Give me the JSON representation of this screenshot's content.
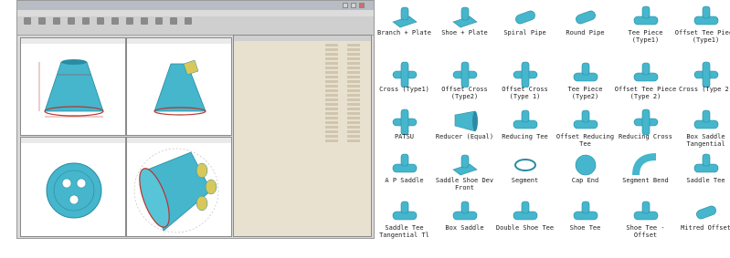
{
  "app": {
    "title": "",
    "menu": [
      "",
      "",
      "",
      "",
      "",
      "",
      ""
    ],
    "toolbar": [
      "",
      "",
      "",
      "",
      "",
      "",
      "",
      "",
      "",
      "",
      "",
      ""
    ],
    "colors": {
      "shape": "#45b6cc",
      "shape_dark": "#2a8ca3",
      "weld": "#b8332c",
      "table_bg": "#e9e1cf"
    }
  },
  "viewports": [
    {
      "view": "front-view"
    },
    {
      "view": "side-view"
    },
    {
      "view": "top-view"
    },
    {
      "view": "3d-view"
    }
  ],
  "palette": {
    "items": [
      {
        "label": "Branch + Plate",
        "icon": "branch-plate-icon"
      },
      {
        "label": "Shoe + Plate",
        "icon": "shoe-plate-icon"
      },
      {
        "label": "Spiral Pipe",
        "icon": "spiral-pipe-icon"
      },
      {
        "label": "Round Pipe",
        "icon": "round-pipe-icon"
      },
      {
        "label": "Tee Piece (Type1)",
        "icon": "tee-piece-type1-icon"
      },
      {
        "label": "Offset Tee Piece (Type1)",
        "icon": "offset-tee-piece-type1-icon"
      },
      {
        "label": "Cross (Type1)",
        "icon": "cross-type1-icon"
      },
      {
        "label": "Offset Cross (Type2)",
        "icon": "offset-cross-type2-icon"
      },
      {
        "label": "Offset Cross (Type 1)",
        "icon": "offset-cross-type-1-icon"
      },
      {
        "label": "Tee Piece (Type2)",
        "icon": "tee-piece-type2-icon"
      },
      {
        "label": "Offset Tee Piece (Type 2)",
        "icon": "offset-tee-piece-type-2-icon"
      },
      {
        "label": "Cross (Type 2)",
        "icon": "cross-type-2-icon"
      },
      {
        "label": "PATSU",
        "icon": "patsu-icon"
      },
      {
        "label": "Reducer (Equal)",
        "icon": "reducer-equal-icon"
      },
      {
        "label": "Reducing Tee",
        "icon": "reducing-tee-icon"
      },
      {
        "label": "Offset Reducing Tee",
        "icon": "offset-reducing-tee-icon"
      },
      {
        "label": "Reducing Cross",
        "icon": "reducing-cross-icon"
      },
      {
        "label": "Box Saddle Tangential",
        "icon": "box-saddle-tangential-icon"
      },
      {
        "label": "A P Saddle",
        "icon": "ap-saddle-icon"
      },
      {
        "label": "Saddle Shoe Dev Front",
        "icon": "saddle-shoe-dev-front-icon"
      },
      {
        "label": "Segment",
        "icon": "segment-icon"
      },
      {
        "label": "Cap End",
        "icon": "cap-end-icon"
      },
      {
        "label": "Segment Bend",
        "icon": "segment-bend-icon"
      },
      {
        "label": "Saddle Tee",
        "icon": "saddle-tee-icon"
      },
      {
        "label": "Saddle Tee Tangential Tl",
        "icon": "saddle-tee-tangential-icon"
      },
      {
        "label": "Box Saddle",
        "icon": "box-saddle-icon"
      },
      {
        "label": "Double Shoe Tee",
        "icon": "double-shoe-tee-icon"
      },
      {
        "label": "Shoe Tee",
        "icon": "shoe-tee-icon"
      },
      {
        "label": "Shoe Tee - Offset",
        "icon": "shoe-tee-offset-icon"
      },
      {
        "label": "Mitred Offset",
        "icon": "mitred-offset-icon"
      }
    ]
  }
}
